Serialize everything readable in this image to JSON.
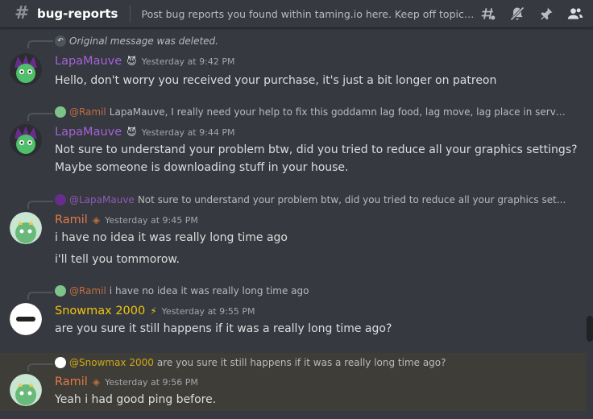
{
  "header": {
    "channel": "bug-reports",
    "topic": "Post bug reports you found within taming.io here. Keep off topic out..."
  },
  "messages": [
    {
      "reply": {
        "deleted": "Original message was deleted.",
        "name": "",
        "text": ""
      },
      "author": "LapaMauve",
      "author_color": "#a561d6",
      "badge": "😈",
      "timestamp": "Yesterday at 9:42 PM",
      "lines": [
        "Hello, don't worry you received your purchase, it's just a bit longer on patreon"
      ]
    },
    {
      "reply": {
        "name": "@Ramil",
        "name_color": "#e07b45",
        "text": "LapaMauve, I really need your help to fix this goddamn lag food, lag move, lag place in serve..."
      },
      "author": "LapaMauve",
      "author_color": "#a561d6",
      "badge": "😈",
      "timestamp": "Yesterday at 9:44 PM",
      "lines": [
        "Not sure to understand your problem btw, did you tried to reduce all your graphics settings?",
        "Maybe someone is downloading stuff in your house."
      ]
    },
    {
      "reply": {
        "name": "@LapaMauve",
        "name_color": "#a561d6",
        "text": "Not sure to understand your problem btw, did you tried to reduce all your graphics set..."
      },
      "author": "Ramil",
      "author_color": "#e07b45",
      "badge": "◈",
      "timestamp": "Yesterday at 9:45 PM",
      "lines": [
        "i have no idea it was really long time ago",
        "i'll tell you tommorow."
      ]
    },
    {
      "reply": {
        "name": "@Ramil",
        "name_color": "#e07b45",
        "text": "i have no idea it was really long time ago"
      },
      "author": "Snowmax 2000",
      "author_color": "#f1c40f",
      "badge": "⚡",
      "timestamp": "Yesterday at 9:55 PM",
      "lines": [
        "are you sure it still happens if it was a really long time ago?"
      ]
    },
    {
      "reply": {
        "name": "@Snowmax 2000",
        "name_color": "#f1c40f",
        "text": "are you sure it still happens if it was a really long time ago?"
      },
      "author": "Ramil",
      "author_color": "#e07b45",
      "badge": "◈",
      "timestamp": "Yesterday at 9:56 PM",
      "lines": [
        "Yeah i had good ping before."
      ]
    }
  ]
}
